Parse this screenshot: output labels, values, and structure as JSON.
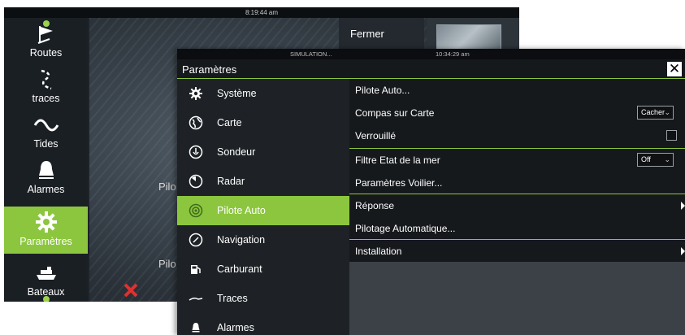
{
  "background": {
    "status_time": "8:19:44 am",
    "fermer_label": "Fermer",
    "pilo_text": "Pilo",
    "sidebar": [
      {
        "label": "Routes",
        "icon": "routes-icon"
      },
      {
        "label": "traces",
        "icon": "traces-icon"
      },
      {
        "label": "Tides",
        "icon": "tides-icon"
      },
      {
        "label": "Alarmes",
        "icon": "alarm-bell-icon"
      },
      {
        "label": "Paramètres",
        "icon": "gear-icon",
        "active": true
      },
      {
        "label": "Bateaux",
        "icon": "vessels-icon"
      }
    ]
  },
  "dialog": {
    "status_mode": "SIMULATION...",
    "status_time": "10:34:29 am",
    "title": "Paramètres",
    "close_glyph": "✕",
    "menu": [
      {
        "label": "Système",
        "icon": "gear-icon"
      },
      {
        "label": "Carte",
        "icon": "globe-icon"
      },
      {
        "label": "Sondeur",
        "icon": "sonar-icon"
      },
      {
        "label": "Radar",
        "icon": "radar-icon"
      },
      {
        "label": "Pilote Auto",
        "icon": "autopilot-icon",
        "active": true
      },
      {
        "label": "Navigation",
        "icon": "compass-icon"
      },
      {
        "label": "Carburant",
        "icon": "fuel-pump-icon"
      },
      {
        "label": "Traces",
        "icon": "trail-icon"
      },
      {
        "label": "Alarmes",
        "icon": "alarm-bell-icon"
      }
    ],
    "settings": {
      "pilote_auto": "Pilote Auto...",
      "compas_label": "Compas sur Carte",
      "compas_value": "Cacher",
      "verrouille_label": "Verrouillé",
      "verrouille_checked": false,
      "filtre_label": "Filtre Etat de la mer",
      "filtre_value": "Off",
      "voilier": "Paramètres Voilier...",
      "reponse": "Réponse",
      "pilotage": "Pilotage Automatique...",
      "installation": "Installation"
    }
  },
  "colors": {
    "accent": "#8cc63f",
    "panel_dark": "#16191c",
    "menu_bg": "#1e2226",
    "content_bg": "#3b4147"
  }
}
